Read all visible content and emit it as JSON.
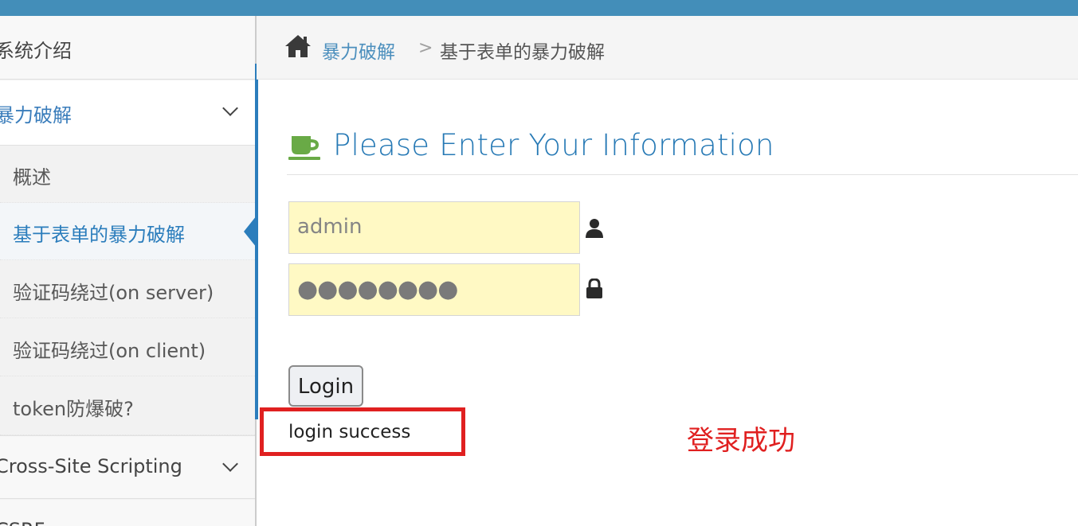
{
  "breadcrumb": {
    "home_icon": "home-icon",
    "parent": "暴力破解",
    "separator": ">",
    "current": "基于表单的暴力破解"
  },
  "sidebar": {
    "top_item": "系统介绍",
    "open_section": {
      "label": "暴力破解",
      "icon": "chevron-down-icon"
    },
    "sub_items": [
      {
        "label": "概述"
      },
      {
        "label": "基于表单的暴力破解",
        "active": true
      },
      {
        "label": "验证码绕过(on server)"
      },
      {
        "label": "验证码绕过(on client)"
      },
      {
        "label": "token防爆破?"
      }
    ],
    "next_section": {
      "label": "Cross-Site Scripting",
      "icon": "chevron-down-icon"
    },
    "partial_item": "CSRF"
  },
  "main": {
    "header_icon": "coffee-cup-icon",
    "title": "Please Enter Your Information",
    "username": {
      "value": "admin",
      "icon": "user-icon"
    },
    "password": {
      "value": "●●●●●●●●",
      "icon": "lock-icon"
    },
    "login_label": "Login",
    "result": "login success"
  },
  "annotation": "登录成功",
  "colors": {
    "topbar": "#438eb9",
    "accent": "#2b7dbc",
    "title": "#2679b5",
    "field_bg": "#fff9c4",
    "cup": "#69aa46",
    "highlight": "#e02020"
  }
}
